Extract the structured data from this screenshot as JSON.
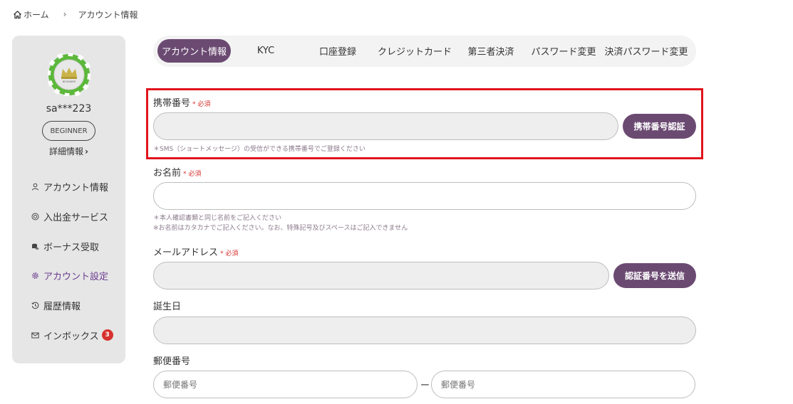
{
  "breadcrumb": {
    "home": "ホーム",
    "current": "アカウント情報"
  },
  "profile": {
    "username": "sa***223",
    "rank": "BEGINNER",
    "details_link": "詳細情報",
    "avatar_label": "BEGINNER"
  },
  "sidebar": {
    "items": [
      {
        "label": "アカウント情報",
        "icon": "user-icon"
      },
      {
        "label": "入出金サービス",
        "icon": "coin-icon"
      },
      {
        "label": "ボーナス受取",
        "icon": "coins-stack-icon"
      },
      {
        "label": "アカウント設定",
        "icon": "gear-icon"
      },
      {
        "label": "履歴情報",
        "icon": "history-icon"
      },
      {
        "label": "インボックス",
        "icon": "mail-icon",
        "badge": "3"
      }
    ]
  },
  "tabs": [
    "アカウント情報",
    "KYC",
    "口座登録",
    "クレジットカード",
    "第三者決済",
    "パスワード変更",
    "決済パスワード変更"
  ],
  "form": {
    "required_mark": "* 必須",
    "phone": {
      "label": "携帯番号",
      "button": "携帯番号認証",
      "note": "＊SMS（ショートメッセージ）の受信ができる携帯番号でご登録ください"
    },
    "name": {
      "label": "お名前",
      "note1": "＊本人確認書類と同じ名前をご記入ください",
      "note2": "※お名前はカタカナでご記入ください。なお、特殊記号及びスペースはご記入できません"
    },
    "email": {
      "label": "メールアドレス",
      "button": "認証番号を送信"
    },
    "birthday": {
      "label": "誕生日"
    },
    "postal": {
      "label": "郵便番号",
      "placeholder1": "郵便番号",
      "placeholder2": "郵便番号",
      "separator": "ー"
    }
  },
  "colors": {
    "accent": "#6b4a72",
    "active_text": "#6a3b8f",
    "highlight": "#e0141c",
    "required": "#d6322f"
  }
}
